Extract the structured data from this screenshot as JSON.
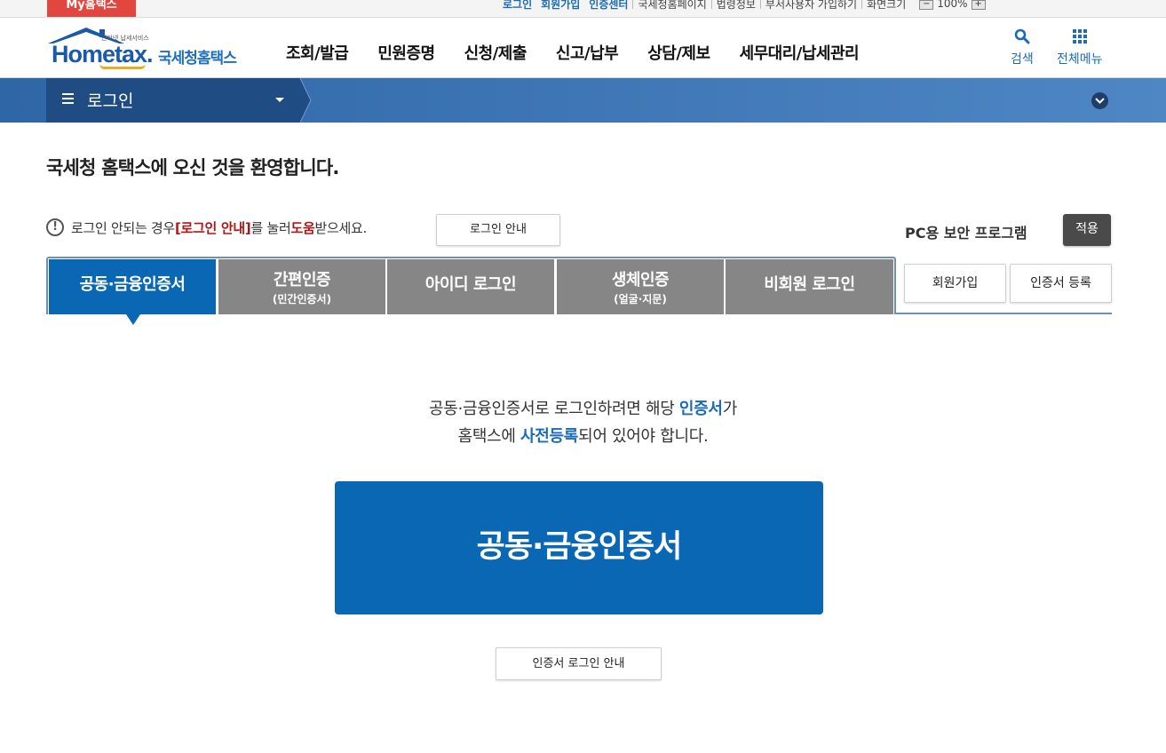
{
  "utility": {
    "my_hometax": "My홈택스",
    "links": [
      "로그인",
      "회원가입",
      "인증센터",
      "국세청홈페이지",
      "법령정보",
      "부서사용자 가입하기",
      "화면크기"
    ],
    "zoom_minus": "−",
    "zoom_value": "100%",
    "zoom_plus": "+"
  },
  "logo": {
    "tagline": "인터넷 납세서비스",
    "english": "Hometax.",
    "korean": "국세청홈택스"
  },
  "gnb": [
    "조회/발급",
    "민원증명",
    "신청/제출",
    "신고/납부",
    "상담/제보",
    "세무대리/납세관리"
  ],
  "header_tools": {
    "search": "검색",
    "all_menu": "전체메뉴"
  },
  "location": {
    "title": "로그인"
  },
  "welcome": "국세청 홈택스에 오신 것을 환영합니다.",
  "notice": {
    "icon": "!",
    "pre": "로그인 안되는 경우 ",
    "highlight1": "[로그인 안내]",
    "mid": "를 눌러 ",
    "highlight2": "도움",
    "post": "받으세요.",
    "guide_button": "로그인 안내"
  },
  "security": {
    "label": "PC용 보안 프로그램",
    "apply_button": "적용"
  },
  "tabs": [
    {
      "label": "공동·금융인증서",
      "sub": ""
    },
    {
      "label": "간편인증",
      "sub": "(민간인증서)"
    },
    {
      "label": "아이디 로그인",
      "sub": ""
    },
    {
      "label": "생체인증",
      "sub": "(얼굴·지문)"
    },
    {
      "label": "비회원 로그인",
      "sub": ""
    }
  ],
  "side_buttons": {
    "join": "회원가입",
    "cert_register": "인증서 등록"
  },
  "content": {
    "line1_pre": "공동·금융인증서로 로그인하려면 해당 ",
    "line1_highlight": "인증서",
    "line1_post": "가",
    "line2_pre": "홈택스에 ",
    "line2_highlight": "사전등록",
    "line2_post": "되어 있어야 합니다.",
    "main_button": "공동·금융인증서",
    "cert_guide_button": "인증서 로그인 안내"
  },
  "colors": {
    "brand_blue": "#0a67b3",
    "tab_inactive": "#868686",
    "nav_bar": "#3d72b0",
    "nav_dark": "#1f4c82",
    "my_hometax_red": "#e2473f",
    "notice_red": "#b01515"
  }
}
